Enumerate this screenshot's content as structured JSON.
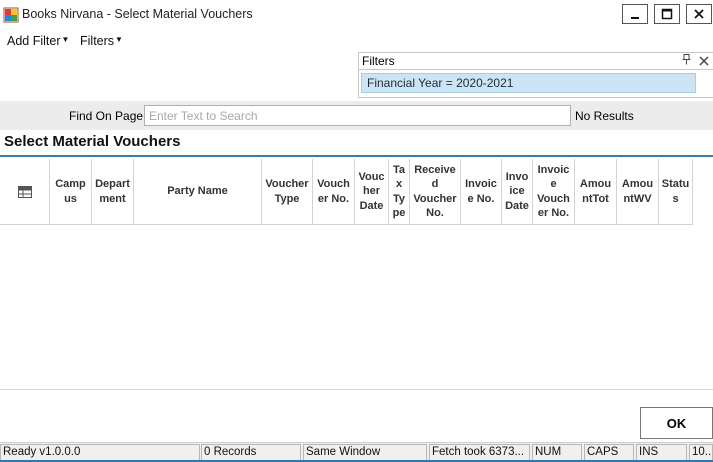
{
  "window": {
    "title": "Books Nirvana - Select Material Vouchers",
    "minimize_label": "▁",
    "maximize_label": "☐",
    "close_label": "✕"
  },
  "menu": {
    "add_filter": "Add Filter",
    "filters": "Filters"
  },
  "filters_panel": {
    "title": "Filters",
    "pin_icon": "pin-icon",
    "close_icon": "close-icon",
    "chip": "Financial Year = 2020-2021"
  },
  "find": {
    "label": "Find On Page",
    "placeholder": "Enter Text to Search",
    "result": "No Results"
  },
  "section": {
    "title": "Select Material Vouchers"
  },
  "grid": {
    "columns": [
      "Camp us",
      "Depart ment",
      "Party Name",
      "Voucher Type",
      "Vouch er No.",
      "Vouc her Date",
      "Ta x Ty pe",
      "Receive d Voucher No.",
      "Invoic e No.",
      "Invo ice Date",
      "Invoic e Vouch er No.",
      "Amou ntTot",
      "Amou ntWV",
      "Statu s"
    ]
  },
  "buttons": {
    "ok": "OK"
  },
  "statusbar": {
    "ready": "Ready v1.0.0.0",
    "records": "0 Records",
    "window_mode": "Same Window",
    "fetch": "Fetch took 6373...",
    "num": "NUM",
    "caps": "CAPS",
    "ins": "INS",
    "extra": "10..."
  },
  "colors": {
    "accent": "#3b7ea6",
    "chip_bg": "#cde4f5",
    "status_accent": "#2b79b8"
  }
}
